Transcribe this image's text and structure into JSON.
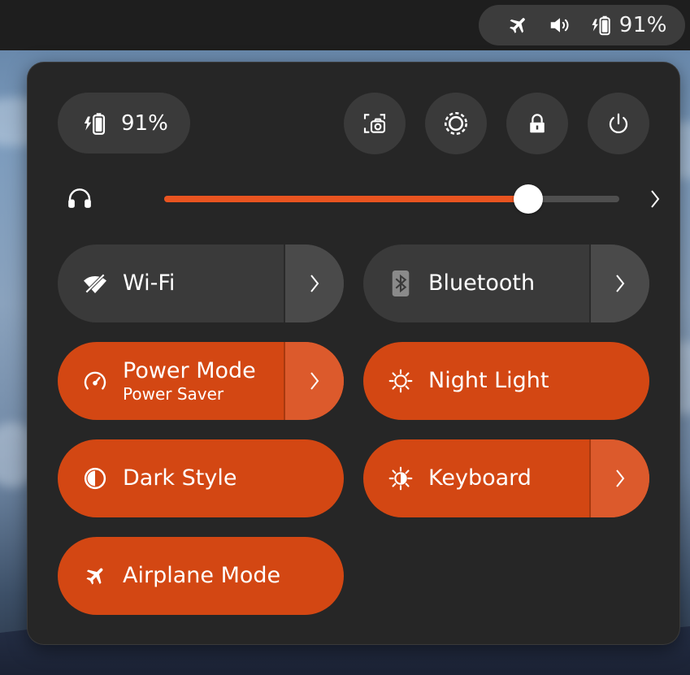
{
  "topbar": {
    "tray_icons": [
      "airplane-icon",
      "volume-icon",
      "battery-charging-icon"
    ],
    "battery_percent": "91%"
  },
  "quick_settings": {
    "battery": {
      "icon": "battery-charging-icon",
      "label": "91%"
    },
    "actions": [
      {
        "name": "screenshot-button",
        "icon": "screenshot-camera-icon"
      },
      {
        "name": "settings-button",
        "icon": "gear-icon"
      },
      {
        "name": "lock-button",
        "icon": "lock-icon"
      },
      {
        "name": "power-button",
        "icon": "power-icon"
      }
    ],
    "volume": {
      "icon": "headphones-icon",
      "level_percent": 80
    },
    "tiles": {
      "wifi": {
        "label": "Wi-Fi",
        "icon": "wifi-disabled-icon",
        "active": false
      },
      "bluetooth": {
        "label": "Bluetooth",
        "icon": "bluetooth-icon",
        "active": false
      },
      "power_mode": {
        "label": "Power Mode",
        "sublabel": "Power Saver",
        "icon": "power-mode-gauge-icon",
        "active": true
      },
      "night_light": {
        "label": "Night Light",
        "icon": "night-light-icon",
        "active": true
      },
      "dark_style": {
        "label": "Dark Style",
        "icon": "dark-style-icon",
        "active": true
      },
      "keyboard": {
        "label": "Keyboard",
        "icon": "keyboard-brightness-icon",
        "active": true
      },
      "airplane_mode": {
        "label": "Airplane Mode",
        "icon": "airplane-icon",
        "active": true
      }
    },
    "colors": {
      "accent": "#e95420",
      "tile_active": "#d34713",
      "tile_inactive": "#3a3a3a",
      "panel_bg": "#262626"
    }
  }
}
